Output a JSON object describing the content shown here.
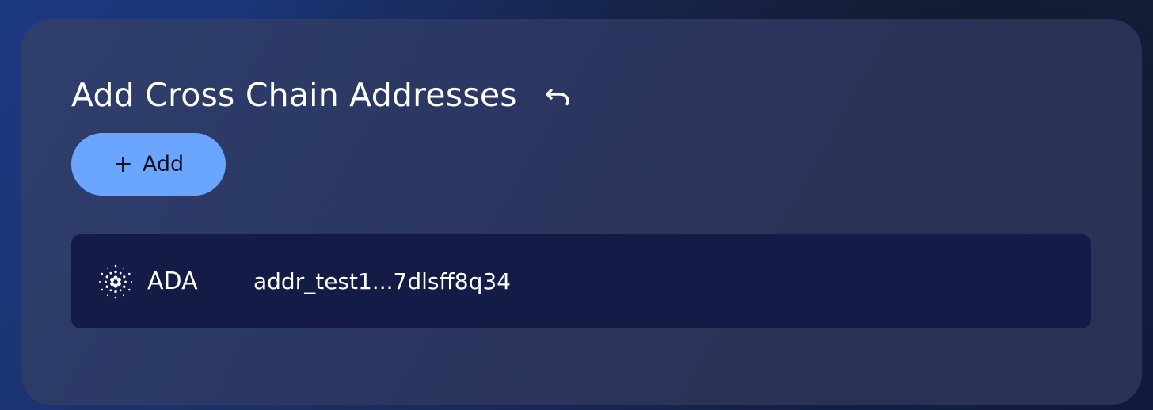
{
  "panel": {
    "title": "Add Cross Chain Addresses",
    "undo_icon": "undo-icon",
    "add_button": {
      "icon": "plus-icon",
      "icon_glyph": "+",
      "label": "Add",
      "color": "#6aa6ff"
    }
  },
  "addresses": [
    {
      "chain_icon": "cardano-icon",
      "symbol": "ADA",
      "address": "addr_test1...7dlsff8q34"
    }
  ],
  "colors": {
    "card_background": "#2b3762",
    "row_background": "#151b47",
    "accent": "#6aa6ff"
  }
}
